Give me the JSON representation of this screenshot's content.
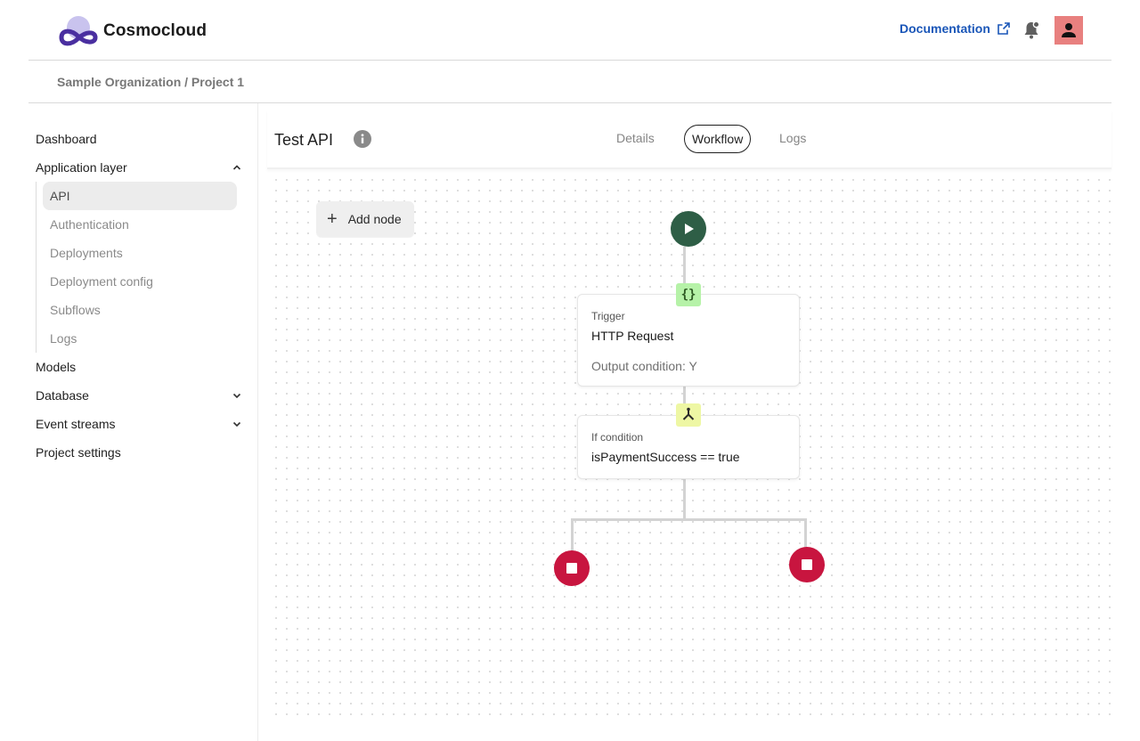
{
  "header": {
    "brand": "Cosmocloud",
    "documentation_label": "Documentation",
    "icons": [
      "cosmocloud-logo",
      "external-link-icon",
      "bell-icon",
      "user-icon"
    ],
    "avatar_color": "#e8807f",
    "link_color": "#1a56b8"
  },
  "breadcrumb": {
    "text": "Sample Organization / Project 1"
  },
  "sidebar": {
    "items": [
      {
        "label": "Dashboard"
      },
      {
        "label": "Application layer",
        "expanded": true
      },
      {
        "label": "Models"
      },
      {
        "label": "Database",
        "expanded": false
      },
      {
        "label": "Event streams",
        "expanded": false
      },
      {
        "label": "Project settings"
      }
    ],
    "subitems": [
      {
        "label": "API",
        "active": true
      },
      {
        "label": "Authentication"
      },
      {
        "label": "Deployments"
      },
      {
        "label": "Deployment config"
      },
      {
        "label": "Subflows"
      },
      {
        "label": "Logs"
      }
    ]
  },
  "main": {
    "title": "Test API",
    "tabs": [
      {
        "label": "Details"
      },
      {
        "label": "Workflow",
        "active": true
      },
      {
        "label": "Logs"
      }
    ],
    "add_node_label": "Add node"
  },
  "workflow": {
    "start_color": "#2e5e46",
    "stop_color": "#c8153f",
    "nodes": [
      {
        "kind": "Trigger",
        "title": "HTTP Request",
        "subtitle": "Output condition: Y",
        "badge": "{}",
        "badge_color": "#b6f2a8"
      },
      {
        "kind": "If condition",
        "title": "isPaymentSuccess == true",
        "badge_icon": "fork-icon",
        "badge_color": "#eef7a4"
      }
    ]
  }
}
